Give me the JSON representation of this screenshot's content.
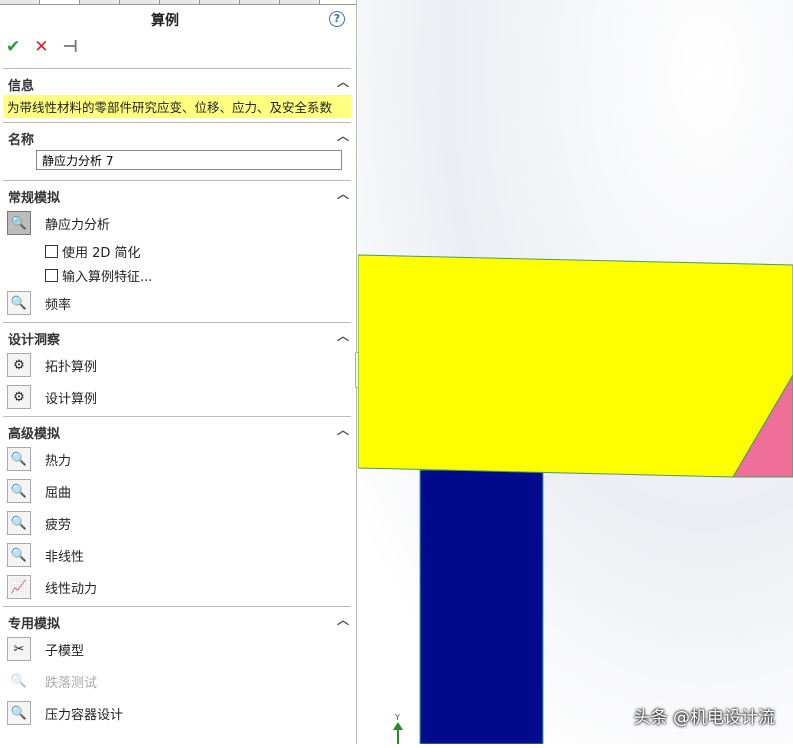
{
  "panel": {
    "title": "算例",
    "help": "?",
    "actions": {
      "ok": "✔",
      "cancel": "✕",
      "pin": "⊣"
    },
    "info": {
      "header": "信息",
      "text": "为带线性材料的零部件研究应变、位移、应力、及安全系数"
    },
    "name": {
      "header": "名称",
      "value": "静应力分析 7"
    },
    "general": {
      "header": "常规模拟",
      "items": [
        {
          "label": "静应力分析",
          "selected": true
        },
        {
          "label": "频率"
        }
      ],
      "options": [
        {
          "label": "使用 2D 简化",
          "checked": false
        },
        {
          "label": "输入算例特征...",
          "checked": false
        }
      ]
    },
    "design": {
      "header": "设计洞察",
      "items": [
        {
          "label": "拓扑算例"
        },
        {
          "label": "设计算例"
        }
      ]
    },
    "advanced": {
      "header": "高级模拟",
      "items": [
        {
          "label": "热力"
        },
        {
          "label": "屈曲"
        },
        {
          "label": "疲劳"
        },
        {
          "label": "非线性"
        },
        {
          "label": "线性动力"
        }
      ]
    },
    "special": {
      "header": "专用模拟",
      "items": [
        {
          "label": "子模型"
        },
        {
          "label": "跌落测试",
          "disabled": true
        },
        {
          "label": "压力容器设计"
        }
      ]
    }
  },
  "viewport": {
    "axis_label": "Y",
    "watermark": "头条 @机电设计流",
    "colors": {
      "beam": "#ffff00",
      "column": "#000a8a",
      "wedge": "#f06e9a"
    }
  }
}
